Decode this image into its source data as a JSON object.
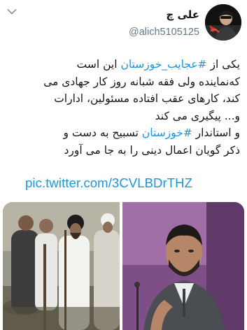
{
  "author": {
    "name": "علی چ",
    "handle": "@alich5105125"
  },
  "tweet": {
    "lines": [
      {
        "pre": "یکی از ",
        "hashtag": "#عجایب_خوزستان",
        "post": " این است"
      },
      {
        "pre": "که‌نماینده ولی فقه شبانه روز کار جهادی می",
        "hashtag": "",
        "post": ""
      },
      {
        "pre": "کند، کارهای عقب افتاده مسئولین، ادارات",
        "hashtag": "",
        "post": ""
      },
      {
        "pre": "و... پیگیری می کند",
        "hashtag": "",
        "post": ""
      },
      {
        "pre": "و استاندار ",
        "hashtag": "#خوزستان",
        "post": " تسبیح به دست و"
      },
      {
        "pre": "ذکر گویان اعمال دینی را به جا می آورد",
        "hashtag": "",
        "post": ""
      }
    ],
    "link": "pic.twitter.com/3CVLBDrTHZ"
  },
  "icons": {
    "menu": "chevron-down-icon"
  },
  "colors": {
    "link": "#1b95e0",
    "handle": "#657786",
    "text": "#14171a"
  }
}
